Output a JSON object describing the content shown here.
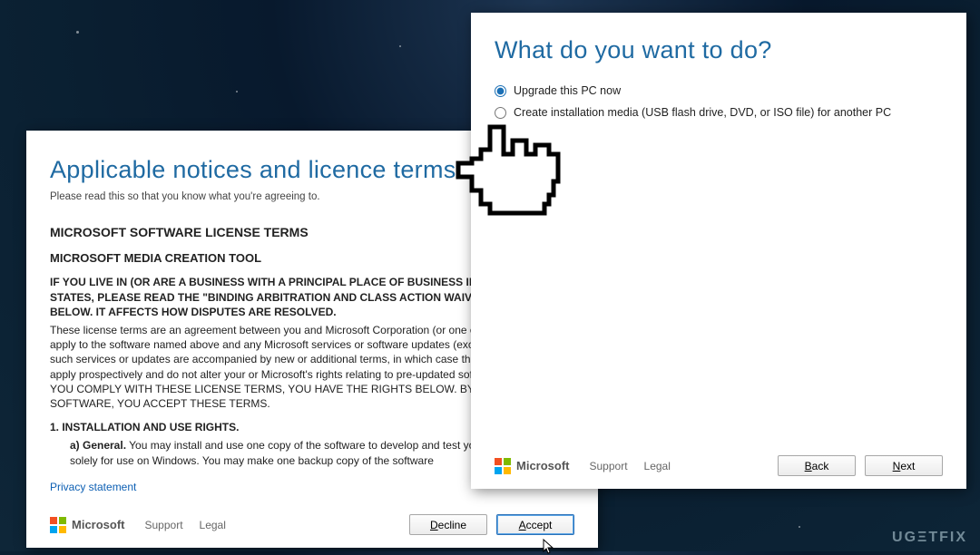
{
  "license": {
    "title": "Applicable notices and licence terms",
    "subtitle": "Please read this so that you know what you're agreeing to.",
    "h1": "MICROSOFT SOFTWARE LICENSE TERMS",
    "h2": "MICROSOFT MEDIA CREATION TOOL",
    "bold1": "IF YOU LIVE IN (OR ARE A BUSINESS WITH A PRINCIPAL PLACE OF BUSINESS IN) THE UNITED STATES, PLEASE READ THE \"BINDING ARBITRATION AND CLASS ACTION WAIVER\" SECTION BELOW. IT AFFECTS HOW DISPUTES ARE RESOLVED.",
    "para1": "These license terms are an agreement between you and Microsoft Corporation (or one of its affiliates). They apply to the software named above and any Microsoft services or software updates (except to the extent such services or updates are accompanied by new or additional terms, in which case those different terms apply prospectively and do not alter your or Microsoft's rights relating to pre-updated software or services). IF YOU COMPLY WITH THESE LICENSE TERMS, YOU HAVE THE RIGHTS BELOW. BY USING THE SOFTWARE, YOU ACCEPT THESE TERMS.",
    "sec1_title": "1.   INSTALLATION AND USE RIGHTS.",
    "sec1a_label": "a)   General.",
    "sec1a_text": " You may install and use one copy of the software to develop and test your applications, and solely for use on Windows. You may make one backup copy of the software",
    "privacy": "Privacy statement",
    "footer": {
      "brand": "Microsoft",
      "support": "Support",
      "legal": "Legal",
      "decline": "Decline",
      "accept": "Accept"
    }
  },
  "choice": {
    "title": "What do you want to do?",
    "opt1": "Upgrade this PC now",
    "opt2": "Create installation media (USB flash drive, DVD, or ISO file) for another PC",
    "footer": {
      "brand": "Microsoft",
      "support": "Support",
      "legal": "Legal",
      "back": "Back",
      "next": "Next"
    }
  },
  "watermark": "UGΞTFIX"
}
